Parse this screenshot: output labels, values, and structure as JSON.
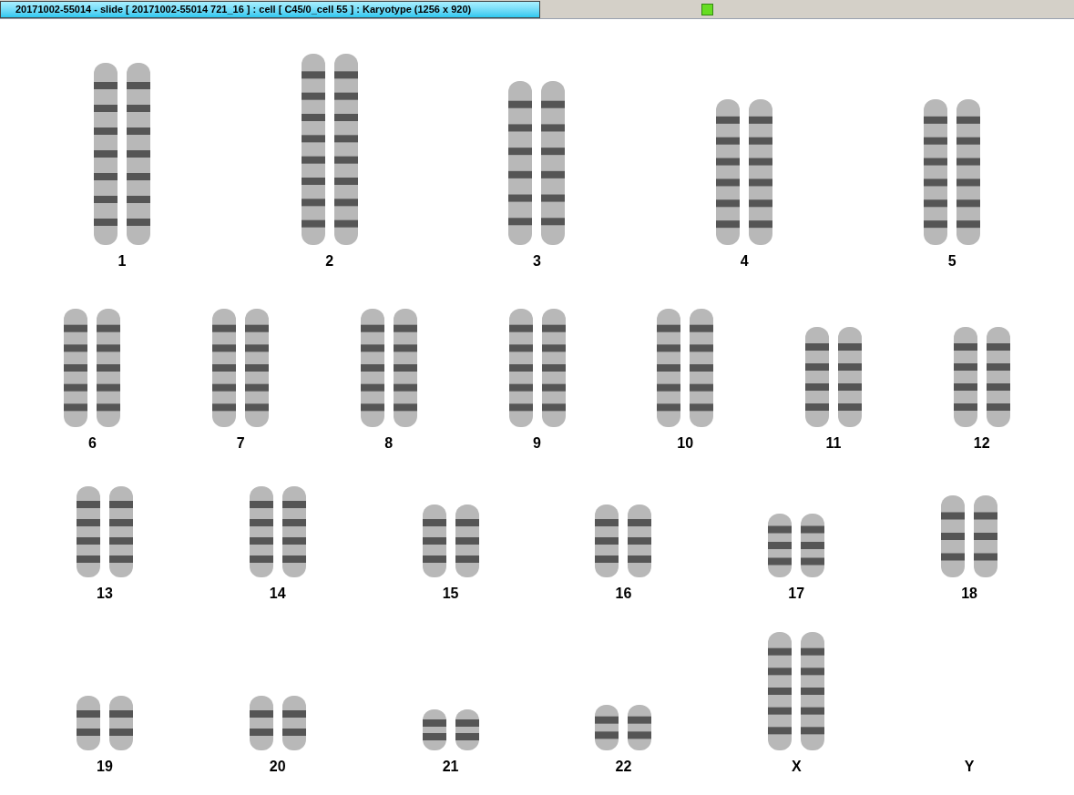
{
  "window": {
    "title": "20171002-55014 - slide [ 20171002-55014 721_16 ] : cell [ C45/0_cell 55 ] : Karyotype  (1256 x 920)"
  },
  "karyotype": {
    "rows": [
      {
        "pairs": [
          {
            "label": "1",
            "kind": "pair"
          },
          {
            "label": "2",
            "kind": "pair"
          },
          {
            "label": "3",
            "kind": "pair"
          },
          {
            "label": "4",
            "kind": "pair"
          },
          {
            "label": "5",
            "kind": "pair"
          }
        ]
      },
      {
        "pairs": [
          {
            "label": "6",
            "kind": "pair"
          },
          {
            "label": "7",
            "kind": "pair"
          },
          {
            "label": "8",
            "kind": "pair"
          },
          {
            "label": "9",
            "kind": "pair"
          },
          {
            "label": "10",
            "kind": "pair"
          },
          {
            "label": "11",
            "kind": "pair"
          },
          {
            "label": "12",
            "kind": "pair"
          }
        ]
      },
      {
        "pairs": [
          {
            "label": "13",
            "kind": "pair"
          },
          {
            "label": "14",
            "kind": "pair"
          },
          {
            "label": "15",
            "kind": "pair"
          },
          {
            "label": "16",
            "kind": "pair"
          },
          {
            "label": "17",
            "kind": "pair"
          },
          {
            "label": "18",
            "kind": "pair"
          }
        ]
      },
      {
        "pairs": [
          {
            "label": "19",
            "kind": "pair"
          },
          {
            "label": "20",
            "kind": "pair"
          },
          {
            "label": "21",
            "kind": "pair"
          },
          {
            "label": "22",
            "kind": "pair"
          },
          {
            "label": "X",
            "kind": "pair"
          },
          {
            "label": "Y",
            "kind": "empty"
          }
        ]
      }
    ]
  }
}
